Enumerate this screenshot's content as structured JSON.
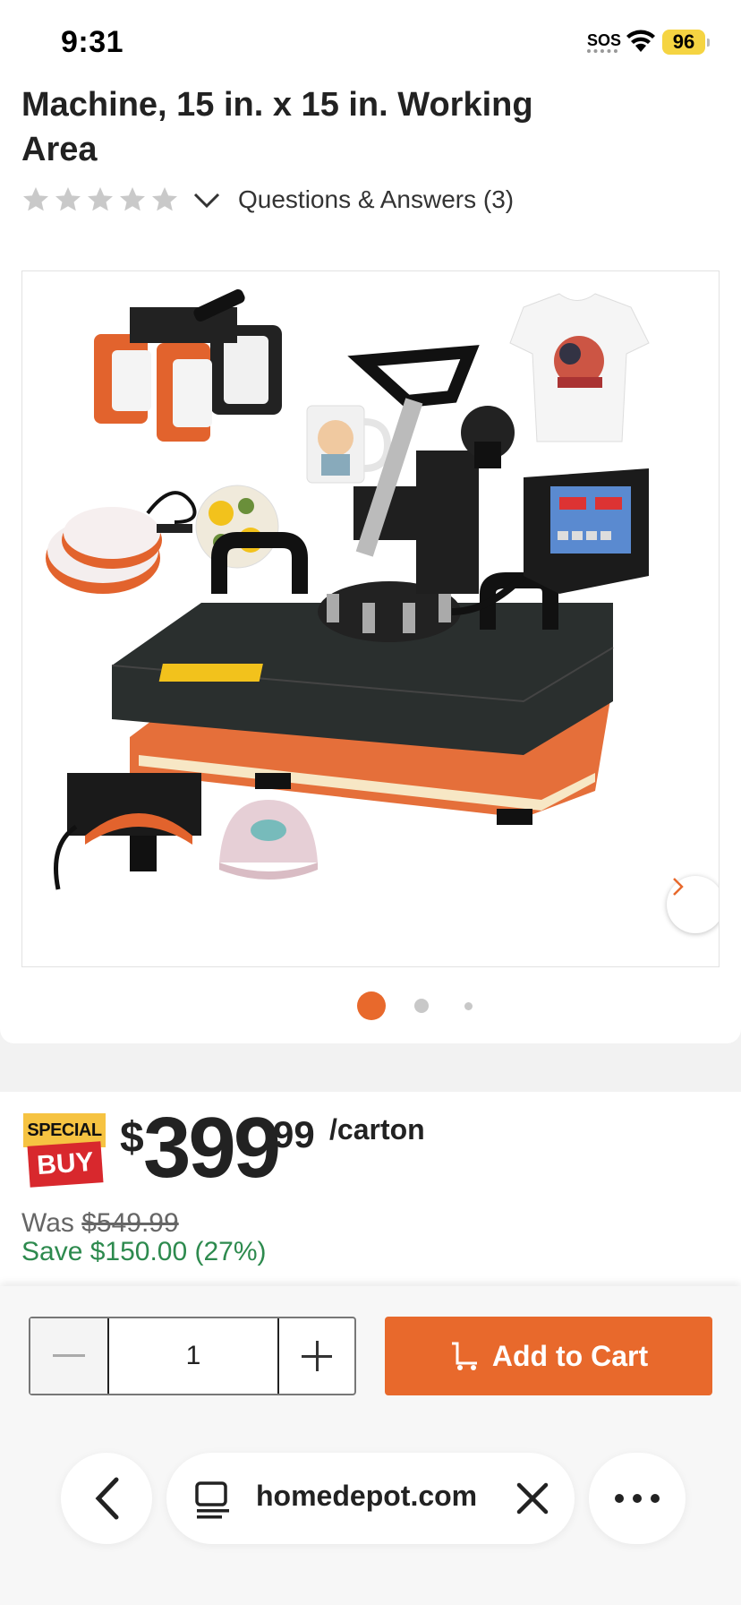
{
  "status_bar": {
    "time": "9:31",
    "sos": "SOS",
    "battery": "96"
  },
  "product": {
    "title": "Machine, 15 in. x 15 in. Working Area",
    "rating_stars": 0,
    "qa_link": "Questions & Answers (3)"
  },
  "gallery": {
    "image_description_icon": "heat-press-product-image",
    "current_index": 1,
    "total_images": 3
  },
  "pricing": {
    "badge_top": "SPECIAL",
    "badge_bottom": "BUY",
    "currency": "$",
    "dollars": "399",
    "cents": "99",
    "unit": "/carton",
    "was_label": "Was",
    "was_price": "$549.99",
    "save_text": "Save $150.00 (27%)"
  },
  "cart": {
    "quantity": "1",
    "add_to_cart_label": "Add to Cart"
  },
  "browser": {
    "url": "homedepot.com"
  },
  "colors": {
    "brand_orange": "#e8692c",
    "save_green": "#2d8a4e",
    "badge_yellow": "#f6c342",
    "badge_red": "#d8282d"
  }
}
